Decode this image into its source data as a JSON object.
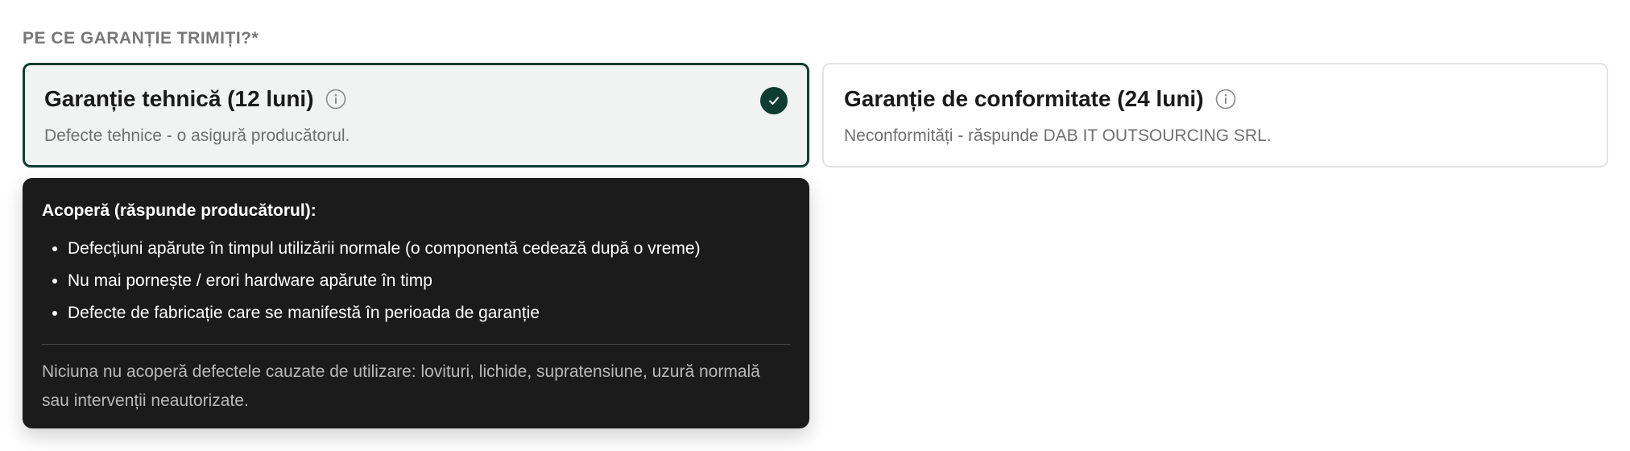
{
  "section": {
    "label": "PE CE GARANȚIE TRIMIȚI?*"
  },
  "options": [
    {
      "title": "Garanție tehnică (12 luni)",
      "description": "Defecte tehnice - o asigură producătorul.",
      "selected": true,
      "icon": "info-icon"
    },
    {
      "title": "Garanție de conformitate (24 luni)",
      "description": "Neconformități - răspunde DAB IT OUTSOURCING SRL.",
      "selected": false,
      "icon": "info-icon"
    }
  ],
  "selected_indicator": {
    "icon": "check-icon",
    "color": "#0f3d31"
  },
  "tooltip": {
    "heading": "Acoperă (răspunde producătorul):",
    "items": [
      "Defecțiuni apărute în timpul utilizării normale (o componentă cedează după o vreme)",
      "Nu mai pornește / erori hardware apărute în timp",
      "Defecte de fabricație care se manifestă în perioada de garanție"
    ],
    "note": "Niciuna nu acoperă defectele cauzate de utilizare: lovituri, lichide, supratensiune, uzură normală sau intervenții neautorizate.",
    "background": "#1b1b1b"
  },
  "colors": {
    "accent": "#0f3d31",
    "selected_card_bg": "#f1f3f2",
    "label": "#777777"
  }
}
